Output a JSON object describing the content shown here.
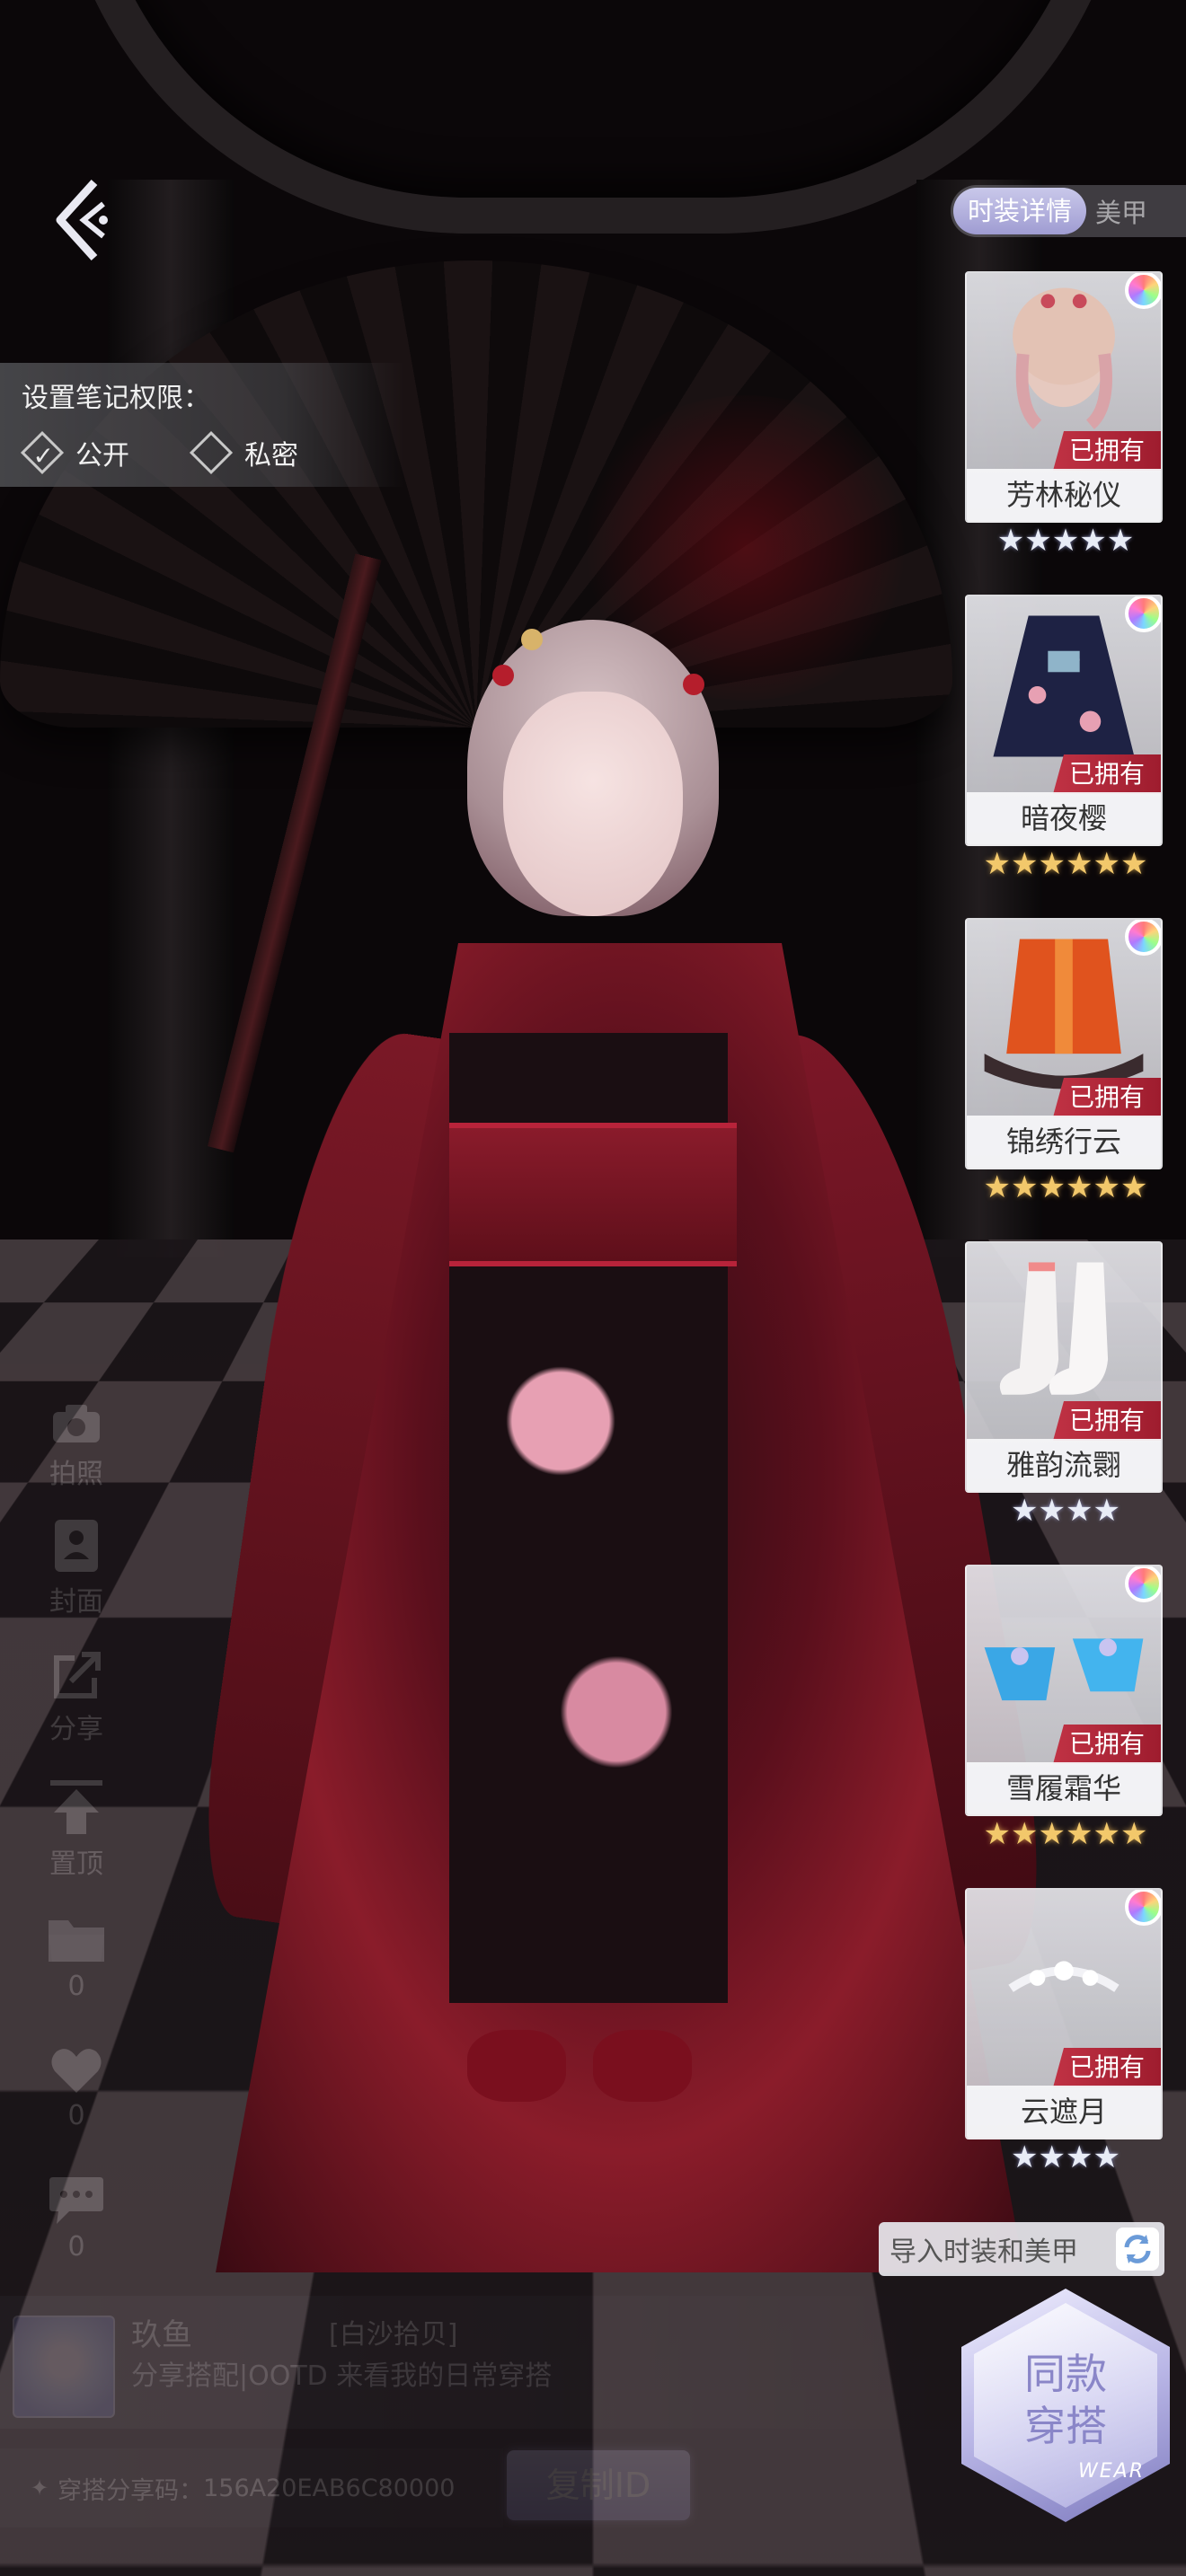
{
  "header": {
    "tabs": [
      {
        "label": "时装详情",
        "active": true
      },
      {
        "label": "美甲",
        "active": false
      }
    ]
  },
  "privacy": {
    "title": "设置笔记权限：",
    "options": [
      {
        "label": "公开",
        "selected": true
      },
      {
        "label": "私密",
        "selected": false
      }
    ]
  },
  "items": [
    {
      "name": "芳林秘仪",
      "status": "已拥有",
      "stars": "★★★★★",
      "star_color": "silver",
      "icon": "hair-icon"
    },
    {
      "name": "暗夜樱",
      "status": "已拥有",
      "stars": "★★★★★★",
      "star_color": "gold",
      "icon": "dress-icon"
    },
    {
      "name": "锦绣行云",
      "status": "已拥有",
      "stars": "★★★★★★",
      "star_color": "gold",
      "icon": "coat-icon"
    },
    {
      "name": "雅韵流翾",
      "status": "已拥有",
      "stars": "★★★★",
      "star_color": "silver",
      "icon": "socks-icon"
    },
    {
      "name": "雪履霜华",
      "status": "已拥有",
      "stars": "★★★★★★",
      "star_color": "gold",
      "icon": "shoes-icon"
    },
    {
      "name": "云遮月",
      "status": "已拥有",
      "stars": "★★★★",
      "star_color": "silver",
      "icon": "hairpin-icon"
    }
  ],
  "side_actions": [
    {
      "label": "拍照",
      "icon": "camera-icon"
    },
    {
      "label": "封面",
      "icon": "cover-icon"
    },
    {
      "label": "分享",
      "icon": "share-icon"
    },
    {
      "label": "置顶",
      "icon": "pin-top-icon"
    },
    {
      "label": "0",
      "icon": "folder-icon"
    },
    {
      "label": "0",
      "icon": "heart-icon"
    },
    {
      "label": "0",
      "icon": "comment-icon"
    }
  ],
  "import_button": {
    "label": "导入时装和美甲"
  },
  "profile": {
    "username": "玖鱼",
    "group": "[白沙拾贝]",
    "note": "分享搭配|OOTD 来看我的日常穿搭"
  },
  "share_code": {
    "label": "穿搭分享码：",
    "code": "156A20EAB6C80000",
    "copy_label": "复制ID"
  },
  "same_outfit": {
    "line1": "同款",
    "line2": "穿搭",
    "sub": "WEAR"
  },
  "colors": {
    "accent": "#9f9cd2",
    "owned_badge": "#c03244",
    "star_gold": "#f2c86b"
  }
}
